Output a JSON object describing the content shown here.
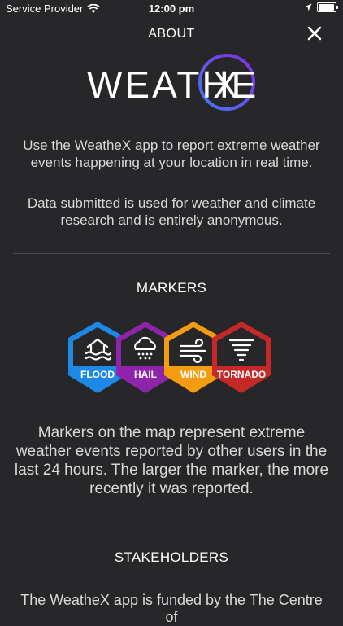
{
  "status_bar": {
    "carrier": "Service Provider",
    "time": "12:00 pm"
  },
  "header": {
    "title": "ABOUT"
  },
  "logo": {
    "text": "WEATHE",
    "letter": "X"
  },
  "intro": [
    "Use the WeatheX app to report extreme weather events happening at your location in real time.",
    "Data submitted is used for weather and climate research and is entirely anonymous."
  ],
  "markers_section": {
    "title": "MARKERS",
    "markers": [
      {
        "label": "FLOOD",
        "color": "#1e88e5",
        "icon": "flood-icon"
      },
      {
        "label": "HAIL",
        "color": "#8e24aa",
        "icon": "hail-icon"
      },
      {
        "label": "WIND",
        "color": "#f39c12",
        "icon": "wind-icon"
      },
      {
        "label": "TORNADO",
        "color": "#c62828",
        "icon": "tornado-icon"
      }
    ],
    "description": "Markers on the map represent extreme weather events reported by other users in the last 24 hours. The larger the marker, the more recently it was reported."
  },
  "stakeholders_section": {
    "title": "STAKEHOLDERS",
    "text": "The WeatheX app is funded by the The Centre of"
  },
  "colors": {
    "background": "#272729",
    "logo_ring_start": "#3d7bf2",
    "logo_ring_end": "#8a2be2"
  }
}
